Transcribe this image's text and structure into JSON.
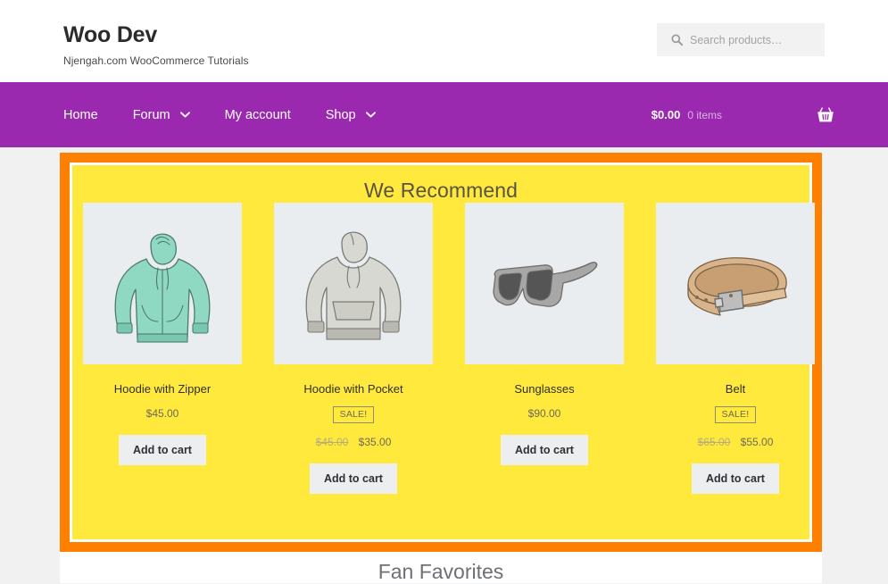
{
  "header": {
    "site_title": "Woo Dev",
    "tagline": "Njengah.com WooCommerce Tutorials",
    "search": {
      "icon": "search-icon",
      "placeholder": "Search products…",
      "value": ""
    }
  },
  "nav": {
    "items": [
      {
        "label": "Home",
        "has_dropdown": false
      },
      {
        "label": "Forum",
        "has_dropdown": true,
        "chevron": "chevron-down-icon"
      },
      {
        "label": "My account",
        "has_dropdown": false
      },
      {
        "label": "Shop",
        "has_dropdown": true,
        "chevron": "chevron-down-icon"
      }
    ],
    "cart": {
      "amount": "$0.00",
      "items": "0 items",
      "icon": "shopping-basket-icon"
    }
  },
  "recommend_section": {
    "title": "We Recommend",
    "highlight_border_color": "#ff8000",
    "background_color": "#ffe93d",
    "products": [
      {
        "name": "Hoodie with Zipper",
        "on_sale": false,
        "sale_badge": "",
        "price": "$45.00",
        "old_price": "",
        "new_price": "",
        "button_label": "Add to cart",
        "image": "hoodie-with-zipper-image"
      },
      {
        "name": "Hoodie with Pocket",
        "on_sale": true,
        "sale_badge": "SALE!",
        "price": "",
        "old_price": "$45.00",
        "new_price": "$35.00",
        "button_label": "Add to cart",
        "image": "hoodie-with-pocket-image"
      },
      {
        "name": "Sunglasses",
        "on_sale": false,
        "sale_badge": "",
        "price": "$90.00",
        "old_price": "",
        "new_price": "",
        "button_label": "Add to cart",
        "image": "sunglasses-image"
      },
      {
        "name": "Belt",
        "on_sale": true,
        "sale_badge": "SALE!",
        "price": "",
        "old_price": "$65.00",
        "new_price": "$55.00",
        "button_label": "Add to cart",
        "image": "belt-image"
      }
    ]
  },
  "fan_section": {
    "title": "Fan Favorites"
  },
  "colors": {
    "nav_purple": "#9b29b0",
    "highlight_orange": "#ff8000",
    "section_yellow": "#ffe93d",
    "page_background": "#f1f1f1",
    "product_image_background": "#e9edf0"
  }
}
